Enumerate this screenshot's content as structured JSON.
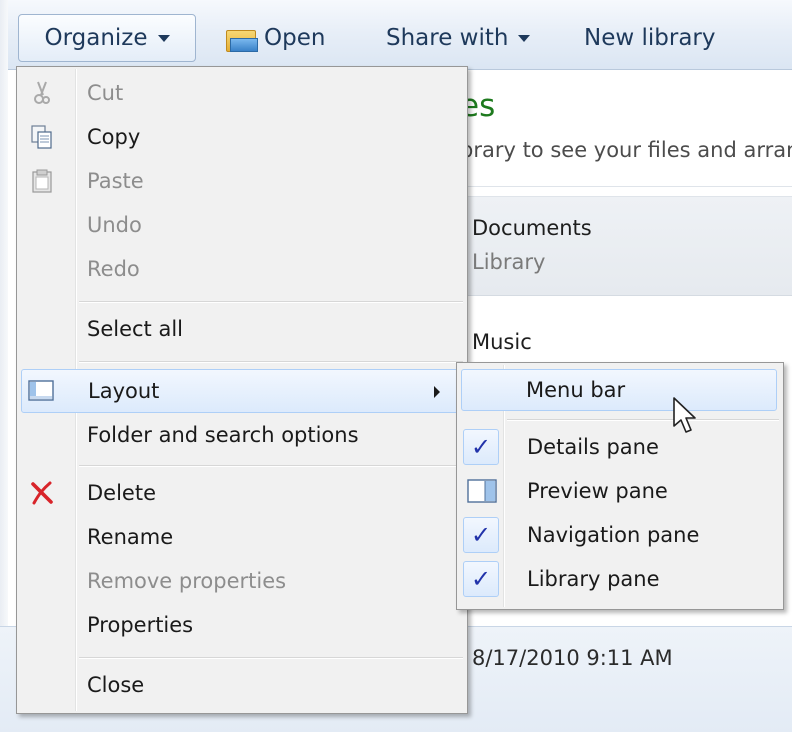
{
  "toolbar": {
    "organize_label": "Organize",
    "open_label": "Open",
    "share_label": "Share with",
    "new_library_label": "New library"
  },
  "content": {
    "title_fragment": "es",
    "description_fragment": "brary to see your files and arran",
    "documents_name": "Documents",
    "documents_sub": "Library",
    "music_name": "Music",
    "date_text": "8/17/2010 9:11 AM"
  },
  "organize_menu": {
    "cut": "Cut",
    "copy": "Copy",
    "paste": "Paste",
    "undo": "Undo",
    "redo": "Redo",
    "select_all": "Select all",
    "layout": "Layout",
    "folder_options": "Folder and search options",
    "delete": "Delete",
    "rename": "Rename",
    "remove_properties": "Remove properties",
    "properties": "Properties",
    "close": "Close"
  },
  "layout_menu": {
    "menu_bar": "Menu bar",
    "details_pane": "Details pane",
    "preview_pane": "Preview pane",
    "navigation_pane": "Navigation pane",
    "library_pane": "Library pane",
    "check_glyph": "✓"
  },
  "icons": {
    "cut": "scissors-icon",
    "copy": "copy-icon",
    "paste": "paste-icon",
    "layout": "layout-icon",
    "delete": "delete-x-icon",
    "preview": "preview-pane-icon",
    "open": "folder-open-icon",
    "cursor": "mouse-pointer-icon"
  },
  "colors": {
    "delete_red": "#d8242a",
    "check_blue": "#2233aa",
    "highlight_border": "#aecff7",
    "title_green": "#1e7a1e"
  }
}
